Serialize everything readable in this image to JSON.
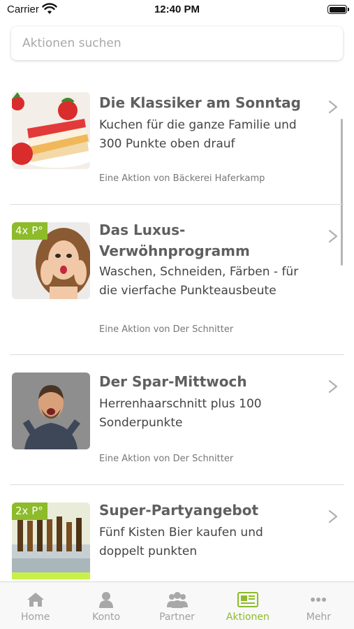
{
  "status": {
    "carrier": "Carrier",
    "time": "12:40 PM"
  },
  "search": {
    "placeholder": "Aktionen suchen"
  },
  "accent_color": "#8dbb2a",
  "items": [
    {
      "title_line1": "Die Klassiker am Sonntag",
      "title_line2": "",
      "desc_line1": "Kuchen für die ganze Familie und",
      "desc_line2": "300 Punkte oben drauf",
      "vendor": "Eine Aktion von Bäckerei Haferkamp",
      "badge": "",
      "image": "strawberry-cake"
    },
    {
      "title_line1": "Das Luxus-",
      "title_line2": "Verwöhnprogramm",
      "desc_line1": "Waschen, Schneiden, Färben - für",
      "desc_line2": "die vierfache Punkteausbeute",
      "vendor": "Eine Aktion von Der Schnitter",
      "badge": "4x P°",
      "image": "surprised-woman"
    },
    {
      "title_line1": "Der Spar-Mittwoch",
      "title_line2": "",
      "desc_line1": "Herrenhaarschnitt plus 100",
      "desc_line2": "Sonderpunkte",
      "vendor": "Eine Aktion von Der Schnitter",
      "badge": "",
      "image": "excited-man"
    },
    {
      "title_line1": "Super-Partyangebot",
      "title_line2": "",
      "desc_line1": "Fünf Kisten Bier kaufen und",
      "desc_line2": "doppelt punkten",
      "vendor": "",
      "badge": "2x P°",
      "image": "beer-bucket"
    }
  ],
  "tabs": [
    {
      "label": "Home",
      "icon": "home-icon",
      "active": false
    },
    {
      "label": "Konto",
      "icon": "person-icon",
      "active": false
    },
    {
      "label": "Partner",
      "icon": "group-icon",
      "active": false
    },
    {
      "label": "Aktionen",
      "icon": "newspaper-icon",
      "active": true
    },
    {
      "label": "Mehr",
      "icon": "more-dots-icon",
      "active": false
    }
  ]
}
